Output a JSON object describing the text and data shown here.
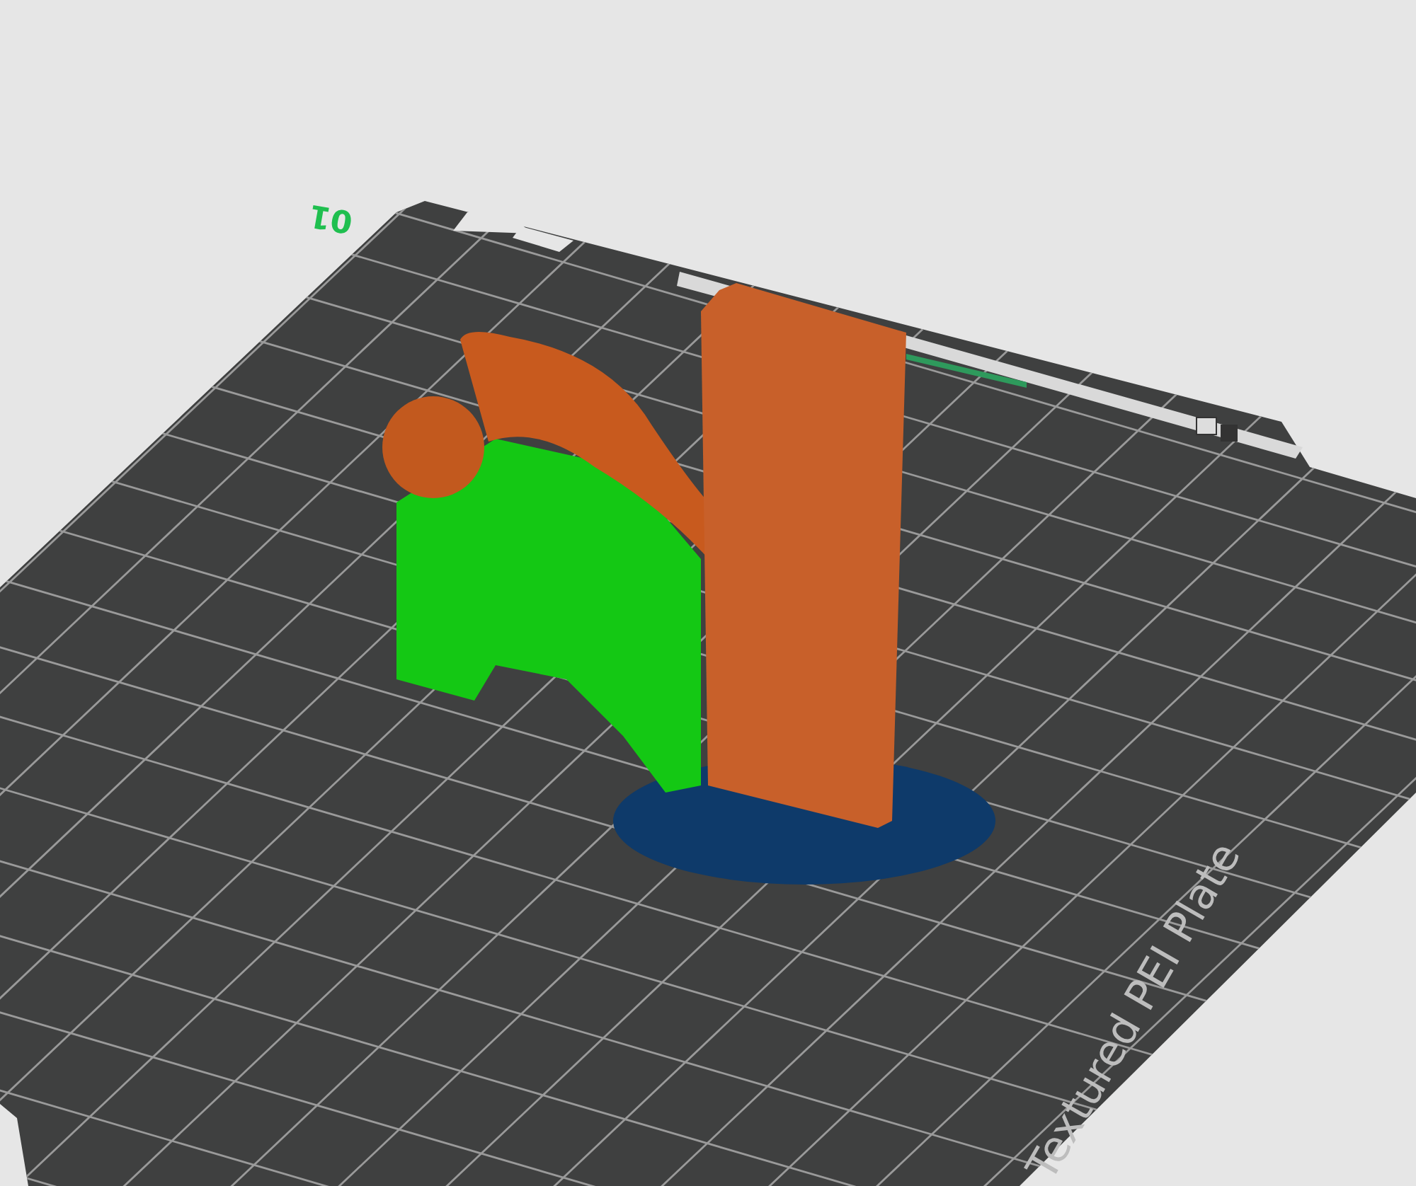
{
  "plate": {
    "number": "01",
    "label": "Textured PEI Plate"
  }
}
